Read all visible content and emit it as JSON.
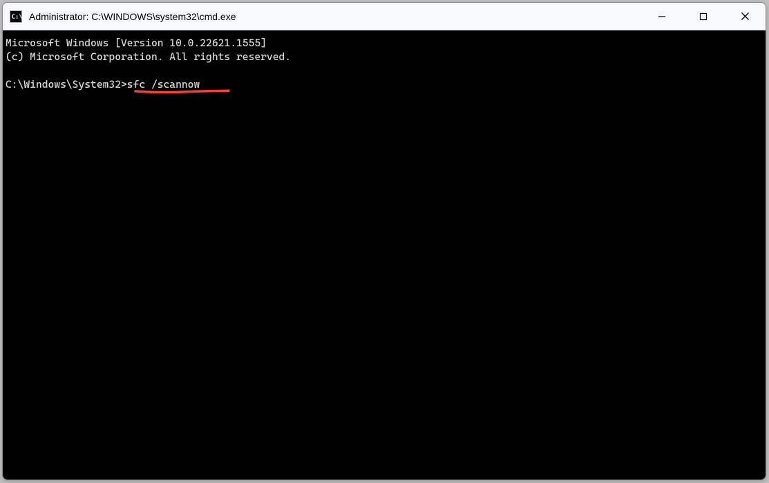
{
  "window": {
    "title": "Administrator: C:\\WINDOWS\\system32\\cmd.exe"
  },
  "terminal": {
    "line1": "Microsoft Windows [Version 10.0.22621.1555]",
    "line2": "(c) Microsoft Corporation. All rights reserved.",
    "prompt": "C:\\Windows\\System32>",
    "command": "sfc /scannow"
  },
  "annotation": {
    "color": "#ff3b3b"
  }
}
